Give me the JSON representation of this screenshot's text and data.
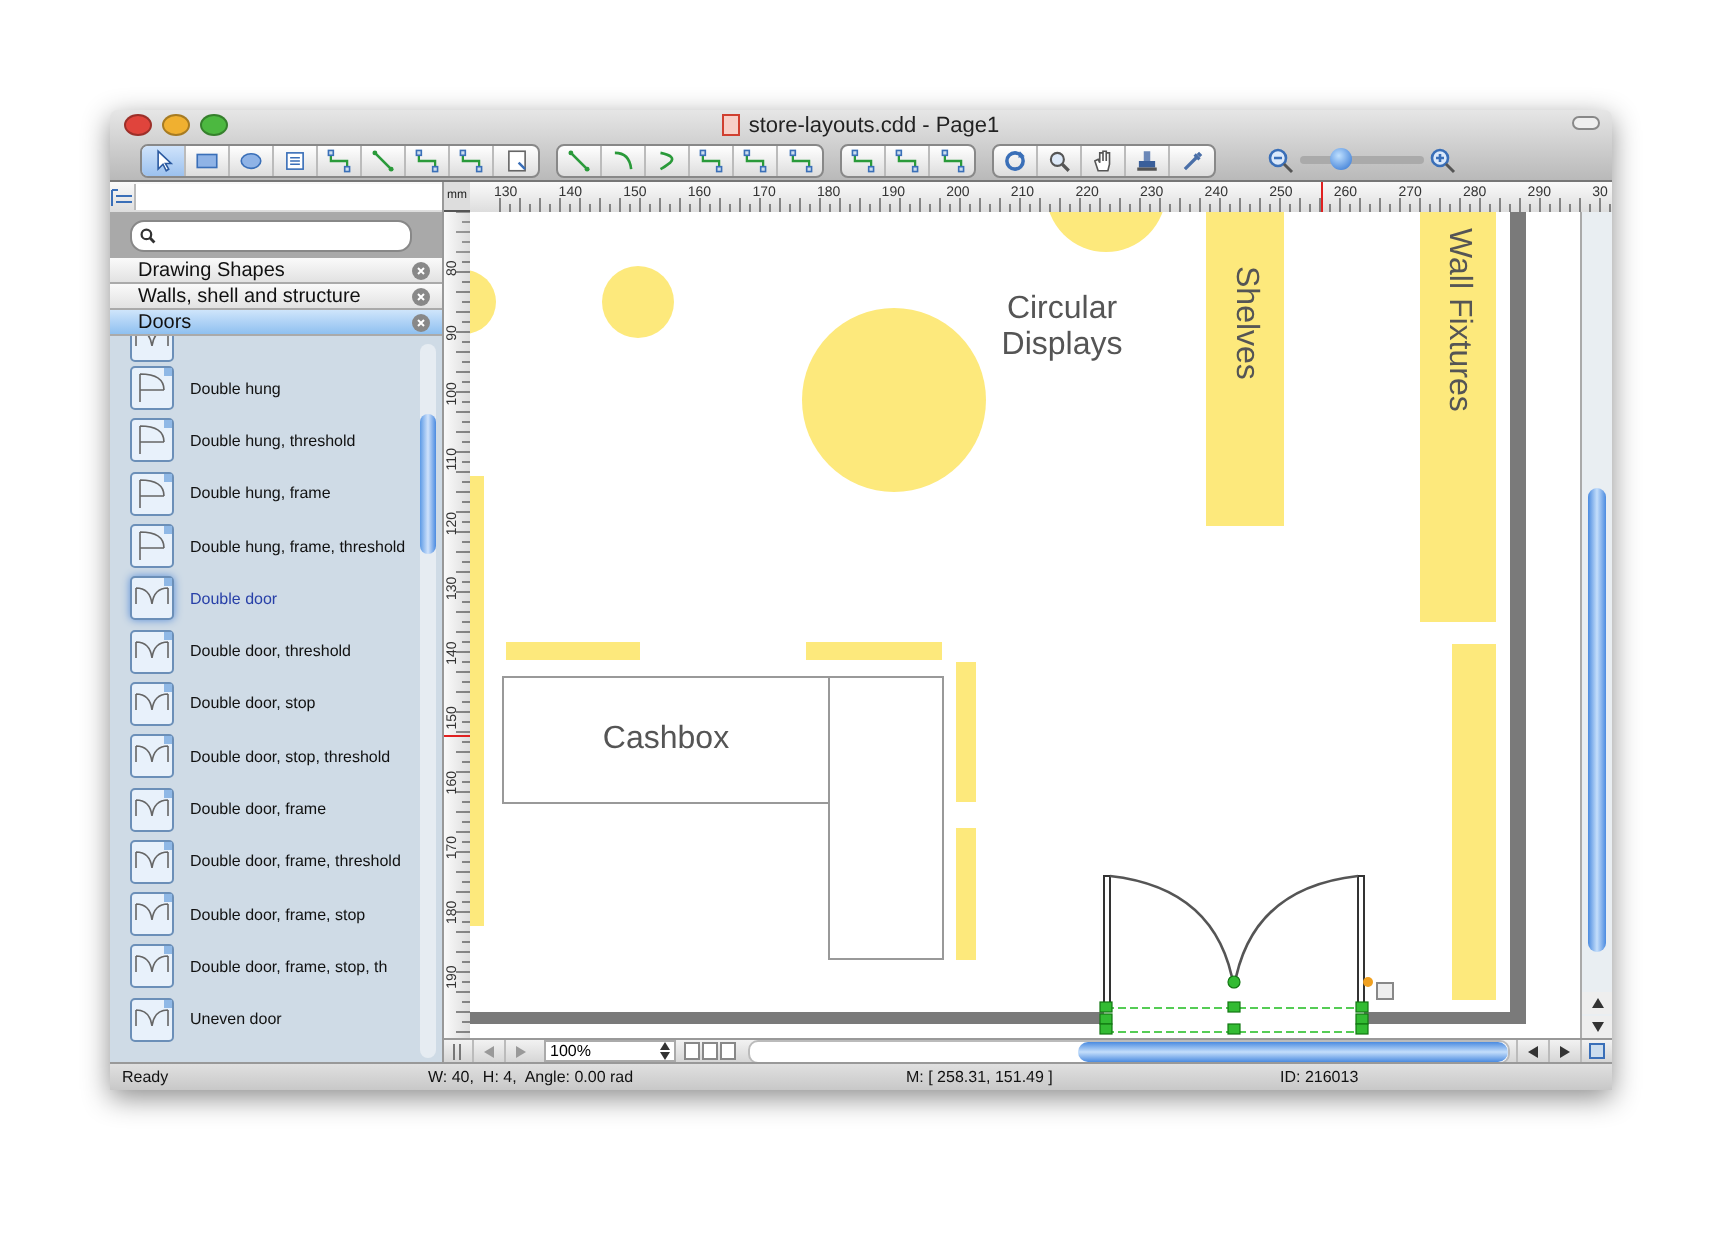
{
  "window": {
    "title": "store-layouts.cdd - Page1"
  },
  "toolbar": {
    "groups": [
      [
        {
          "kind": "pointer",
          "selected": true
        },
        {
          "kind": "rectangle",
          "selected": false
        },
        {
          "kind": "ellipse",
          "selected": false
        },
        {
          "kind": "textbox",
          "selected": false
        },
        {
          "kind": "connector",
          "selected": false
        },
        {
          "kind": "line",
          "selected": false
        },
        {
          "kind": "connector",
          "selected": false
        },
        {
          "kind": "connector",
          "selected": false
        },
        {
          "kind": "page",
          "selected": false
        }
      ],
      [
        {
          "kind": "line",
          "selected": false
        },
        {
          "kind": "arc",
          "selected": false
        },
        {
          "kind": "curve",
          "selected": false
        },
        {
          "kind": "connector",
          "selected": false
        },
        {
          "kind": "connector",
          "selected": false
        },
        {
          "kind": "connector",
          "selected": false
        }
      ],
      [
        {
          "kind": "connector",
          "selected": false
        },
        {
          "kind": "connector",
          "selected": false
        },
        {
          "kind": "connector",
          "selected": false
        }
      ],
      [
        {
          "kind": "rotate",
          "selected": false
        },
        {
          "kind": "zoom",
          "selected": false
        },
        {
          "kind": "hand",
          "selected": false
        },
        {
          "kind": "stamp",
          "selected": false
        },
        {
          "kind": "eyedropper",
          "selected": false
        }
      ]
    ],
    "zoom_slider": {
      "level": 0.32
    }
  },
  "sidebar": {
    "libraries": [
      {
        "name": "Drawing Shapes",
        "selected": false
      },
      {
        "name": "Walls, shell and structure",
        "selected": false
      },
      {
        "name": "Doors",
        "selected": true
      }
    ],
    "items": [
      {
        "label": "Double hung",
        "kind": "hung",
        "selected": false
      },
      {
        "label": "Double hung, threshold",
        "kind": "hung",
        "selected": false
      },
      {
        "label": "Double hung, frame",
        "kind": "hung",
        "selected": false
      },
      {
        "label": "Double hung, frame, threshold",
        "kind": "hung",
        "selected": false
      },
      {
        "label": "Double door",
        "kind": "door",
        "selected": true
      },
      {
        "label": "Double door, threshold",
        "kind": "door",
        "selected": false
      },
      {
        "label": "Double door, stop",
        "kind": "door",
        "selected": false
      },
      {
        "label": "Double door, stop, threshold",
        "kind": "door",
        "selected": false
      },
      {
        "label": "Double door, frame",
        "kind": "door",
        "selected": false
      },
      {
        "label": "Double door, frame, threshold",
        "kind": "door",
        "selected": false
      },
      {
        "label": "Double door, frame, stop",
        "kind": "door",
        "selected": false
      },
      {
        "label": "Double door, frame, stop, th",
        "kind": "door",
        "selected": false
      },
      {
        "label": "Uneven door",
        "kind": "door",
        "selected": false
      }
    ]
  },
  "rulers": {
    "unit": "mm",
    "horizontal": [
      "130",
      "140",
      "150",
      "160",
      "170",
      "180",
      "190",
      "200",
      "210",
      "220",
      "230",
      "240",
      "250",
      "260",
      "270",
      "280",
      "290",
      "30"
    ],
    "vertical": [
      "80",
      "90",
      "100",
      "110",
      "120",
      "130",
      "140",
      "150",
      "160",
      "170",
      "180",
      "190"
    ]
  },
  "canvas": {
    "circular_displays": "Circular Displays",
    "shelves": "Shelves",
    "wall_fixtures": "Wall Fixtures",
    "cashbox": "Cashbox"
  },
  "bottom_bar": {
    "zoom": "100%"
  },
  "status_bar": {
    "state": "Ready",
    "size": "W: 40,  H: 4,  Angle: 0.00 rad",
    "mouse": "M: [ 258.31, 151.49 ]",
    "id": "ID: 216013"
  }
}
